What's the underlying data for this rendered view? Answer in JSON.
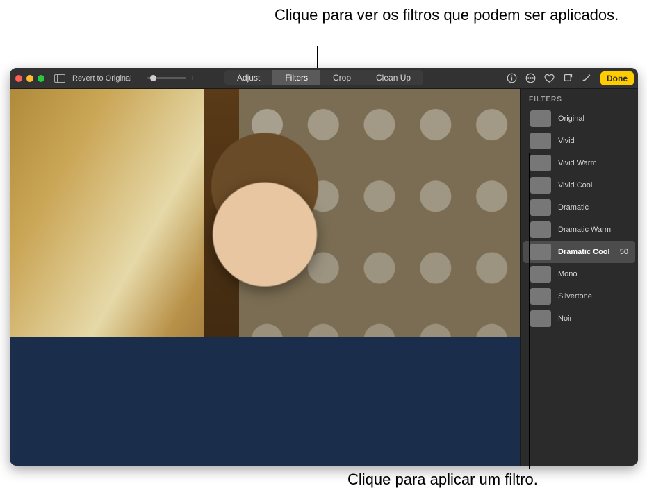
{
  "annotations": {
    "top": "Clique para ver os filtros\nque podem ser aplicados.",
    "bottom": "Clique para aplicar um filtro."
  },
  "toolbar": {
    "revert_label": "Revert to Original",
    "zoom_minus": "−",
    "zoom_plus": "+",
    "tabs": [
      "Adjust",
      "Filters",
      "Crop",
      "Clean Up"
    ],
    "active_tab_index": 1,
    "done_label": "Done"
  },
  "sidebar": {
    "title": "FILTERS",
    "items": [
      {
        "name": "Original",
        "thumb": "t-orig",
        "value": null,
        "selected": false
      },
      {
        "name": "Vivid",
        "thumb": "t-viv",
        "value": null,
        "selected": false
      },
      {
        "name": "Vivid Warm",
        "thumb": "t-vw",
        "value": null,
        "selected": false
      },
      {
        "name": "Vivid Cool",
        "thumb": "t-vc",
        "value": null,
        "selected": false
      },
      {
        "name": "Dramatic",
        "thumb": "t-dr",
        "value": null,
        "selected": false
      },
      {
        "name": "Dramatic Warm",
        "thumb": "t-dw",
        "value": null,
        "selected": false
      },
      {
        "name": "Dramatic Cool",
        "thumb": "t-dc",
        "value": "50",
        "selected": true
      },
      {
        "name": "Mono",
        "thumb": "t-mo",
        "value": null,
        "selected": false
      },
      {
        "name": "Silvertone",
        "thumb": "t-sv",
        "value": null,
        "selected": false
      },
      {
        "name": "Noir",
        "thumb": "t-no",
        "value": null,
        "selected": false
      }
    ]
  }
}
